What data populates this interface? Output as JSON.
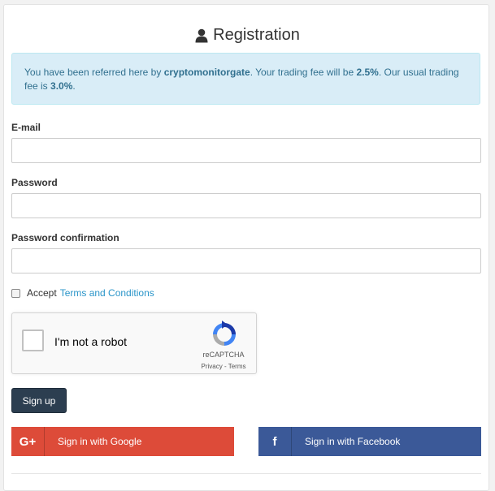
{
  "page": {
    "title": "Registration"
  },
  "alert": {
    "prefix": "You have been referred here by ",
    "referrer": "cryptomonitorgate",
    "mid": ". Your trading fee will be ",
    "fee": "2.5%",
    "mid2": ". Our usual trading fee is ",
    "usual_fee": "3.0%",
    "suffix": "."
  },
  "form": {
    "email_label": "E-mail",
    "email_value": "",
    "password_label": "Password",
    "password_value": "",
    "password_confirmation_label": "Password confirmation",
    "password_confirmation_value": "",
    "accept_text": "Accept",
    "terms_link": "Terms and Conditions"
  },
  "recaptcha": {
    "label": "I'm not a robot",
    "brand": "reCAPTCHA",
    "links": "Privacy - Terms"
  },
  "buttons": {
    "signup": "Sign up",
    "google": "Sign in with Google",
    "google_icon_text": "G+",
    "facebook": "Sign in with Facebook",
    "facebook_icon_text": "f"
  },
  "colors": {
    "alert_bg": "#d9edf7",
    "alert_text": "#31708f",
    "signup_bg": "#2c3e50",
    "google_bg": "#dd4b39",
    "facebook_bg": "#3b5998",
    "link": "#2a95c9"
  },
  "icons": {
    "title_icon": "user-icon",
    "captcha_logo": "recaptcha-logo-icon"
  }
}
